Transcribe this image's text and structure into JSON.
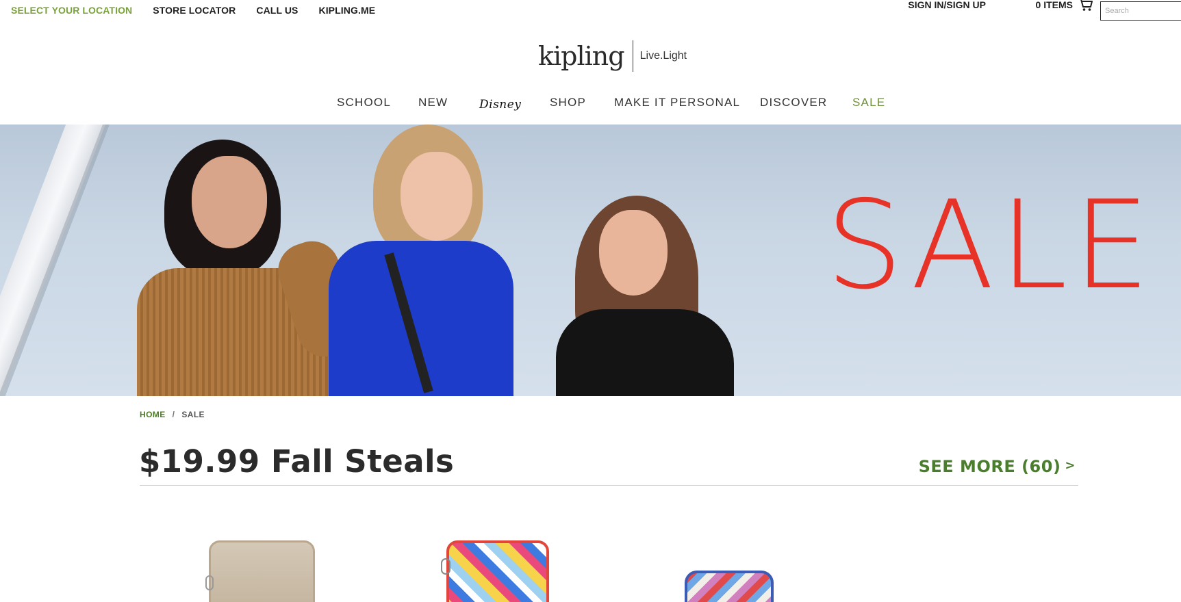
{
  "utility_bar": {
    "links": [
      {
        "label": "SELECT YOUR LOCATION",
        "name": "select-location-link"
      },
      {
        "label": "STORE LOCATOR",
        "name": "store-locator-link"
      },
      {
        "label": "CALL US",
        "name": "call-us-link"
      },
      {
        "label": "KIPLING.ME",
        "name": "kipling-me-link"
      }
    ],
    "sign_in_label": "SIGN IN/SIGN UP",
    "cart_label": "0 ITEMS",
    "search_placeholder": "Search"
  },
  "logo": {
    "brand": "kipling",
    "tagline": "Live.Light"
  },
  "nav": {
    "items": [
      "SCHOOL",
      "NEW",
      "Disney",
      "SHOP",
      "MAKE IT PERSONAL",
      "DISCOVER",
      "SALE"
    ]
  },
  "hero": {
    "headline": "SALE"
  },
  "breadcrumb": {
    "home": "HOME",
    "separator": "/",
    "current": "SALE"
  },
  "section": {
    "title": "$19.99 Fall Steals",
    "see_more": "SEE MORE (60)",
    "see_more_chevron": ">"
  },
  "colors": {
    "accent_green": "#4a7d2c",
    "location_green": "#7aa23a",
    "sale_red": "#e63227",
    "nav_sale_green": "#6f8f3c"
  },
  "icons": {
    "cart": "cart-icon"
  }
}
